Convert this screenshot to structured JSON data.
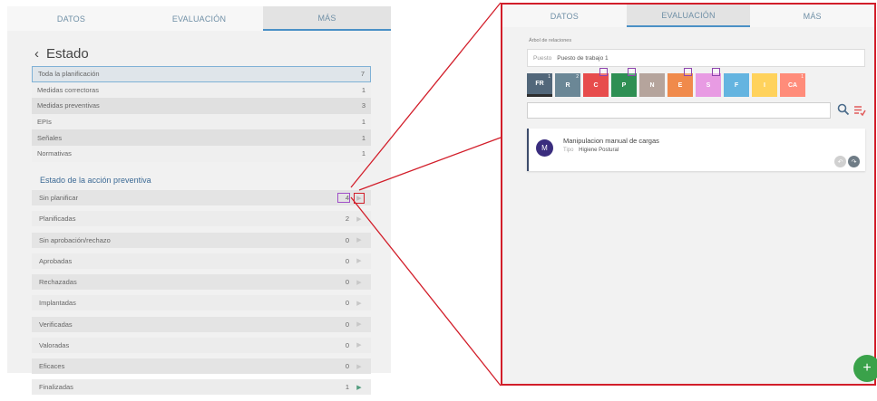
{
  "left": {
    "tabs": [
      {
        "label": "DATOS",
        "active": false
      },
      {
        "label": "EVALUACIÓN",
        "active": false
      },
      {
        "label": "MÁS",
        "active": true
      }
    ],
    "back_glyph": "‹",
    "title": "Estado",
    "rows": [
      {
        "label": "Toda la planificación",
        "count": "7",
        "selected": true
      },
      {
        "label": "Medidas correctoras",
        "count": "1"
      },
      {
        "label": "Medidas preventivas",
        "count": "3"
      },
      {
        "label": "EPIs",
        "count": "1"
      },
      {
        "label": "Señales",
        "count": "1"
      },
      {
        "label": "Normativas",
        "count": "1"
      }
    ],
    "section_title": "Estado de la acción preventiva",
    "actions": [
      {
        "label": "Sin planificar",
        "count": "4",
        "active": true
      },
      {
        "label": "Planificadas",
        "count": "2",
        "active": false
      },
      {
        "label": "Sin aprobación/rechazo",
        "count": "0",
        "active": false
      },
      {
        "label": "Aprobadas",
        "count": "0",
        "active": false
      },
      {
        "label": "Rechazadas",
        "count": "0",
        "active": false
      },
      {
        "label": "Implantadas",
        "count": "0",
        "active": false
      },
      {
        "label": "Verificadas",
        "count": "0",
        "active": false
      },
      {
        "label": "Valoradas",
        "count": "0",
        "active": false
      },
      {
        "label": "Eficaces",
        "count": "0",
        "active": false
      },
      {
        "label": "Finalizadas",
        "count": "1",
        "active": true
      }
    ]
  },
  "right": {
    "tabs": [
      {
        "label": "DATOS",
        "active": false
      },
      {
        "label": "EVALUACIÓN",
        "active": true
      },
      {
        "label": "MÁS",
        "active": false
      }
    ],
    "relations_label": "Árbol de relaciones",
    "puesto_label": "Puesto",
    "puesto_value": "Puesto de trabajo 1",
    "tiles": [
      {
        "label": "FR",
        "sup": "1",
        "color": "#52677a",
        "selected": true
      },
      {
        "label": "R",
        "sup": "2",
        "color": "#6b8796"
      },
      {
        "label": "C",
        "sup": "1",
        "color": "#e74c4c",
        "boxed": true
      },
      {
        "label": "P",
        "sup": "1",
        "color": "#2e8f53",
        "boxed": true
      },
      {
        "label": "N",
        "sup": "",
        "color": "#b5a49c"
      },
      {
        "label": "E",
        "sup": "1",
        "color": "#f08a4b",
        "boxed": true
      },
      {
        "label": "S",
        "sup": "1",
        "color": "#e89be3",
        "boxed": true
      },
      {
        "label": "F",
        "sup": "",
        "color": "#64b4e0"
      },
      {
        "label": "I",
        "sup": "",
        "color": "#ffd25c"
      },
      {
        "label": "CA",
        "sup": "1",
        "color": "#ff8c7a"
      }
    ],
    "card": {
      "avatar": "M",
      "title": "Manipulacion manual de cargas",
      "type_label": "Tipo",
      "type_value": "Higiene Postural"
    },
    "fab_label": "+"
  },
  "colors": {
    "accent": "#4a90c6",
    "highlight_red": "#d21e2a",
    "highlight_purple": "#a050c8",
    "fab": "#3aa24a"
  }
}
